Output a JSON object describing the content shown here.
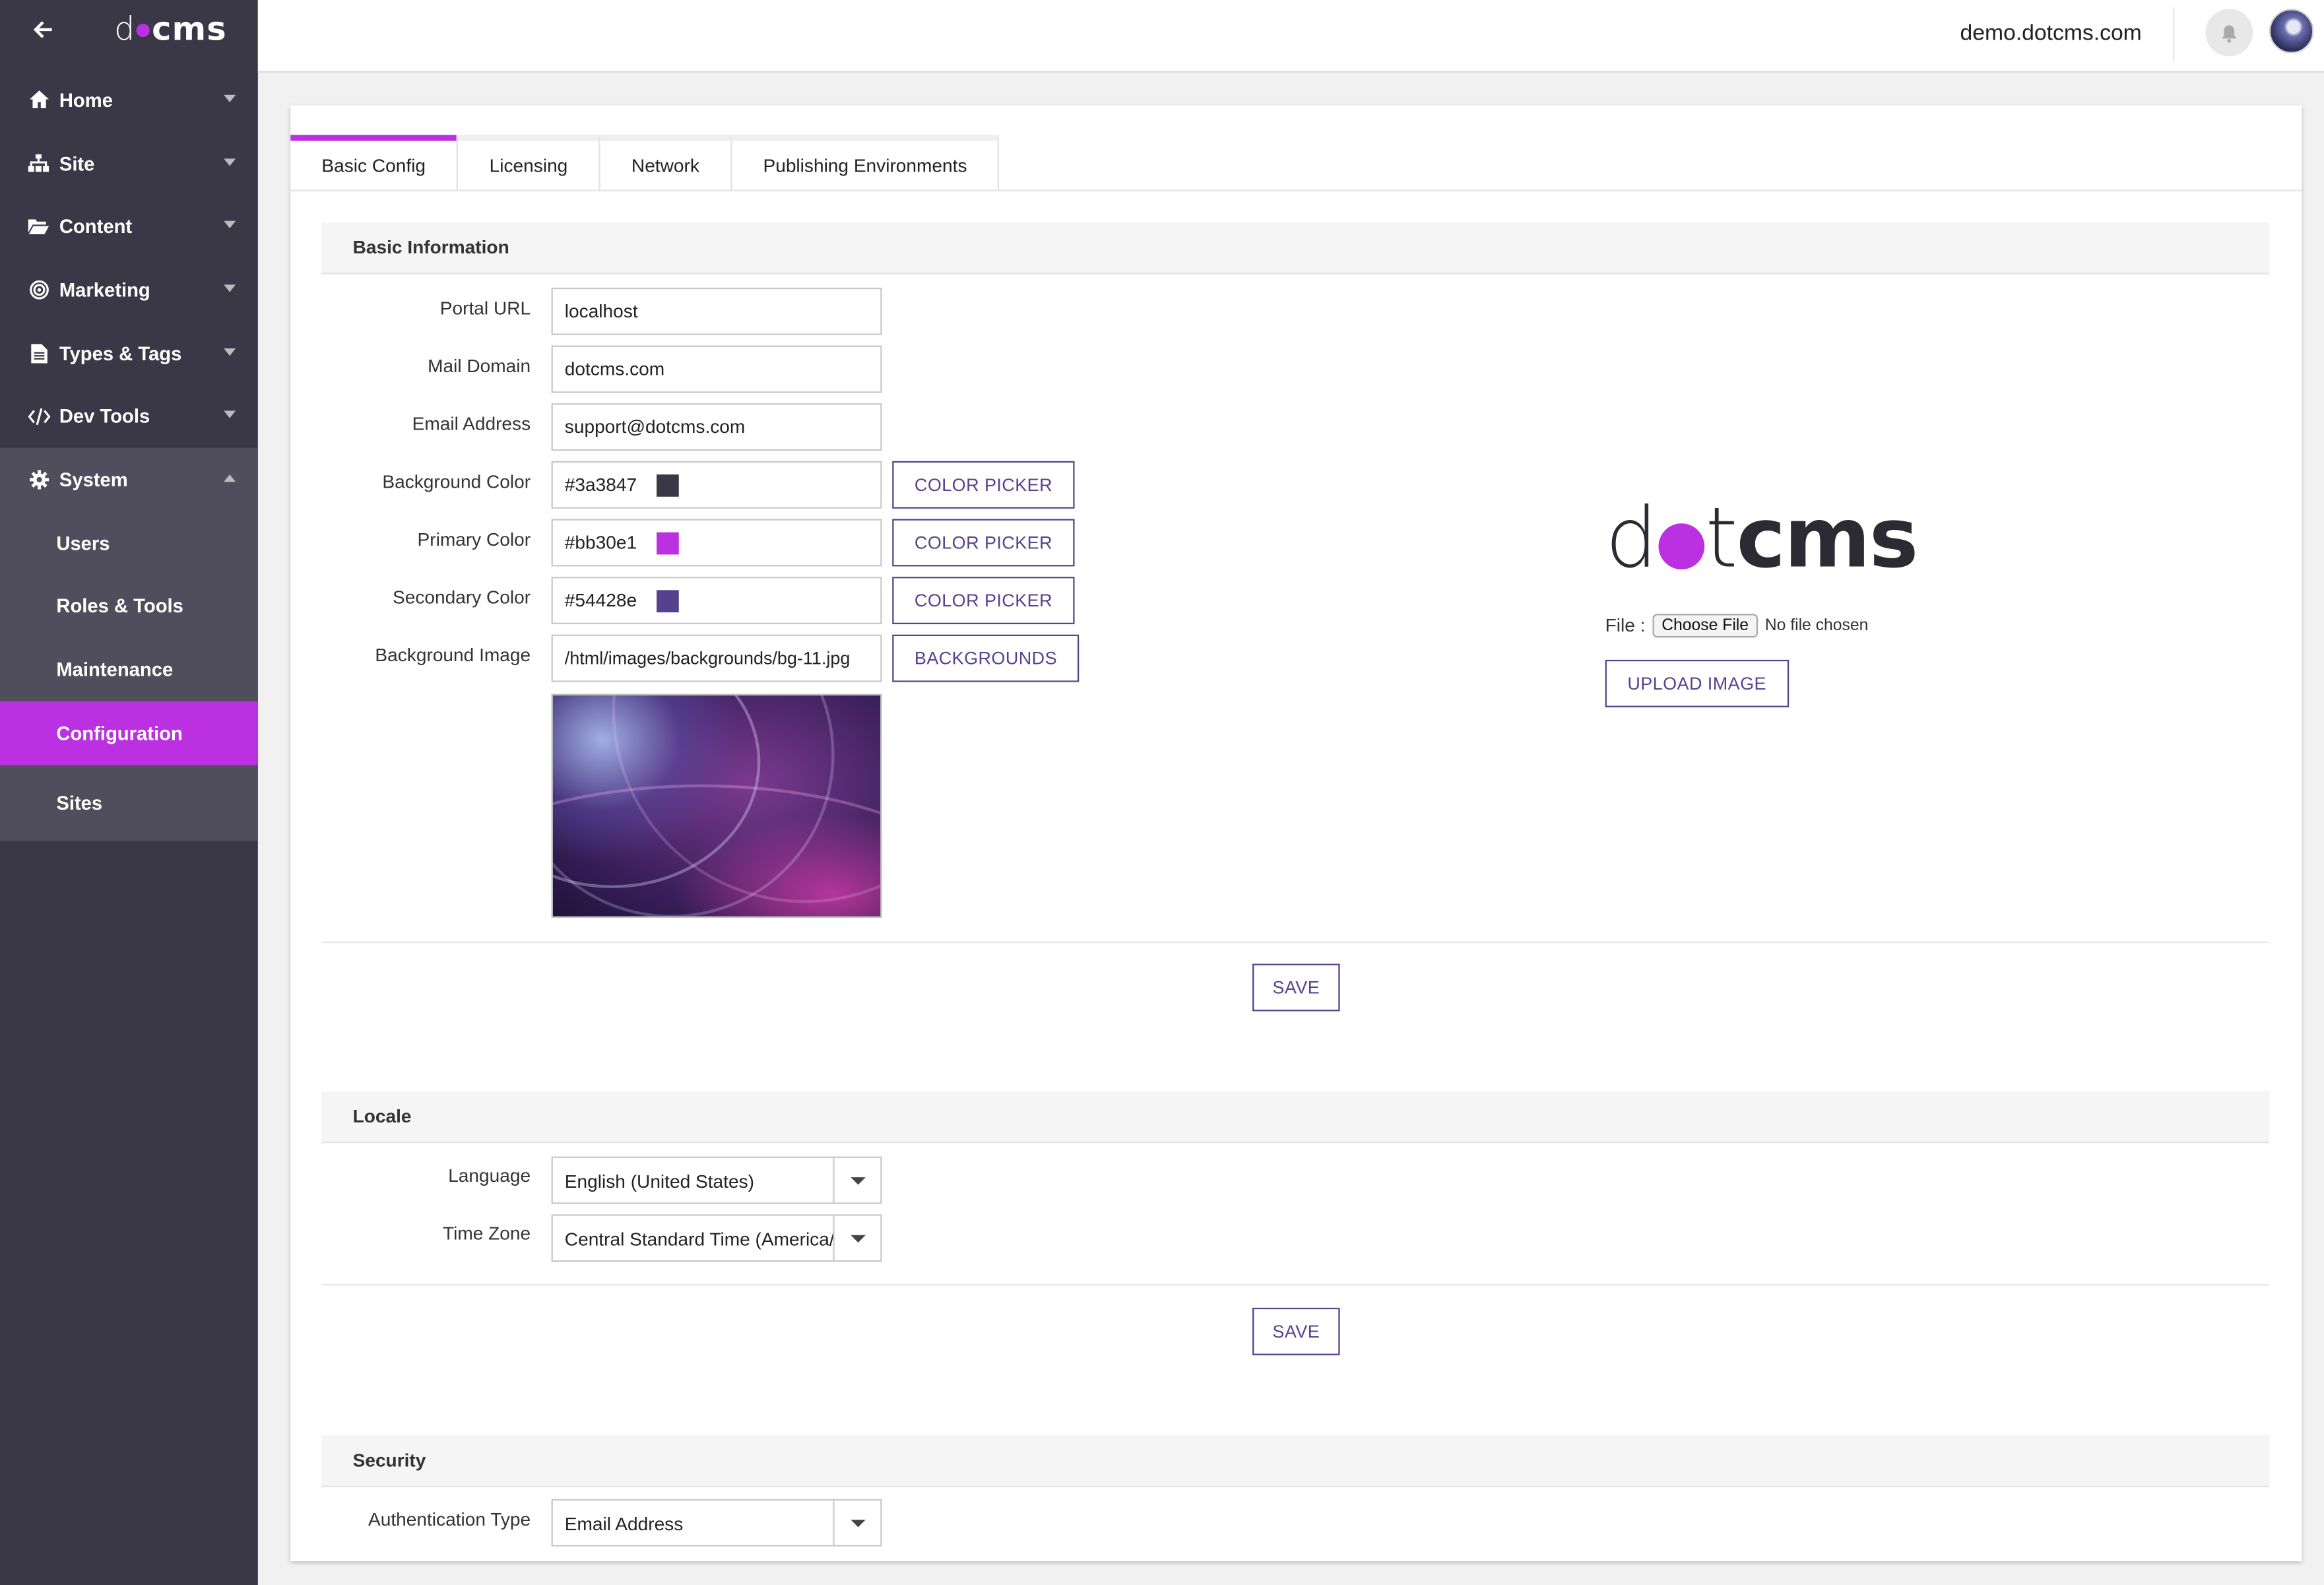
{
  "sidebar": {
    "logo_d": "d",
    "logo_cms": "cms",
    "back_glyph": "🡐",
    "items": [
      {
        "label": "Home",
        "icon": "home-icon"
      },
      {
        "label": "Site",
        "icon": "sitemap-icon"
      },
      {
        "label": "Content",
        "icon": "folder-open-icon"
      },
      {
        "label": "Marketing",
        "icon": "bullseye-icon"
      },
      {
        "label": "Types & Tags",
        "icon": "file-text-icon"
      },
      {
        "label": "Dev Tools",
        "icon": "code-icon"
      },
      {
        "label": "System",
        "icon": "gear-icon"
      }
    ],
    "system_subitems": [
      {
        "label": "Users"
      },
      {
        "label": "Roles & Tools"
      },
      {
        "label": "Maintenance"
      },
      {
        "label": "Configuration",
        "active": true
      },
      {
        "label": "Sites"
      }
    ]
  },
  "topbar": {
    "site": "demo.dotcms.com"
  },
  "tabs": [
    {
      "label": "Basic Config",
      "active": true
    },
    {
      "label": "Licensing"
    },
    {
      "label": "Network"
    },
    {
      "label": "Publishing Environments"
    }
  ],
  "basic_info": {
    "title": "Basic Information",
    "portal_url_label": "Portal URL",
    "portal_url": "localhost",
    "mail_domain_label": "Mail Domain",
    "mail_domain": "dotcms.com",
    "email_label": "Email Address",
    "email": "support@dotcms.com",
    "bg_color_label": "Background Color",
    "bg_color": "#3a3847",
    "primary_color_label": "Primary Color",
    "primary_color": "#bb30e1",
    "secondary_color_label": "Secondary Color",
    "secondary_color": "#54428e",
    "color_picker_label": "COLOR PICKER",
    "bg_image_label": "Background Image",
    "bg_image": "/html/images/backgrounds/bg-11.jpg",
    "backgrounds_label": "BACKGROUNDS",
    "logo_d": "d",
    "logo_t": "t",
    "logo_cms": "cms",
    "file_label": "File :",
    "choose_file": "Choose File",
    "no_file": "No file chosen",
    "upload_label": "UPLOAD IMAGE",
    "save_label": "SAVE"
  },
  "locale": {
    "title": "Locale",
    "language_label": "Language",
    "language": "English (United States)",
    "timezone_label": "Time Zone",
    "timezone": "Central Standard Time (America/Chicago)",
    "save_label": "SAVE"
  },
  "security": {
    "title": "Security",
    "auth_label": "Authentication Type",
    "auth": "Email Address"
  },
  "colors": {
    "sidebar": "#3a3847",
    "accent": "#bb30e1",
    "secondary": "#54428e"
  }
}
